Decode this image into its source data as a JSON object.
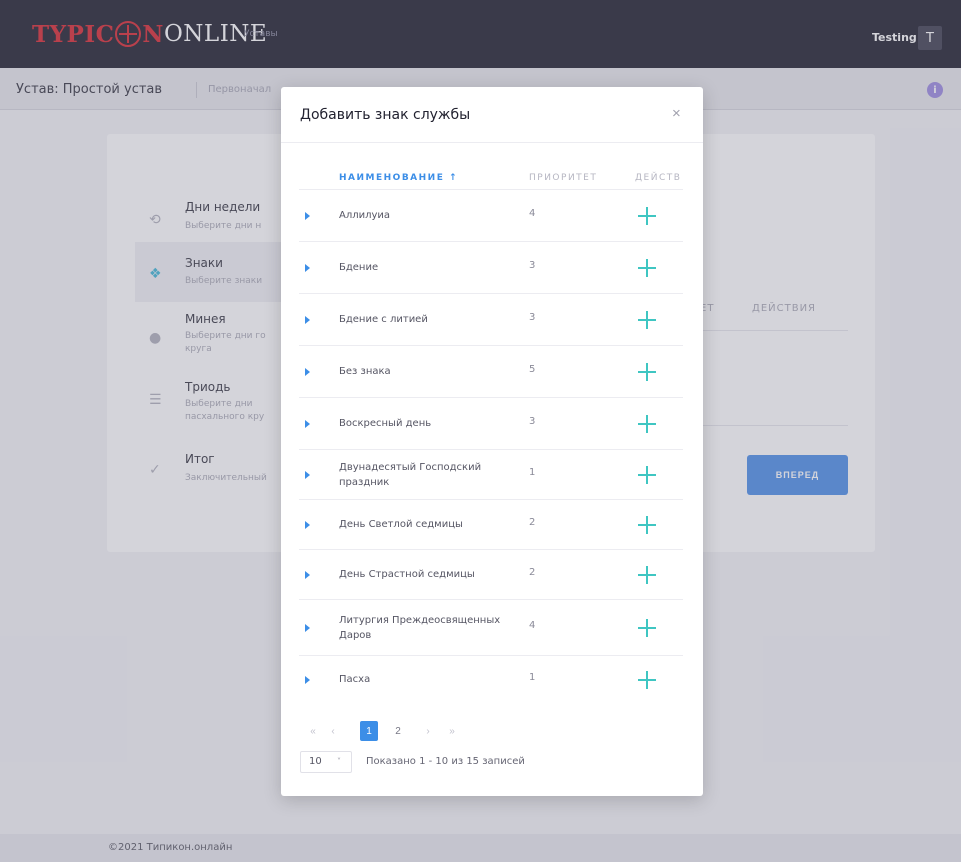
{
  "app": {
    "logo_red": "TYPIC",
    "logo_red2": "N",
    "logo_white": "ONLINE",
    "nav_link": "Уставы",
    "user_name": "Testing",
    "user_initial": "T"
  },
  "subheader": {
    "title": "Устав: Простой устав",
    "link": "Первоначал",
    "info": "i"
  },
  "steps": [
    {
      "title": "Дни недели",
      "desc": "Выберите дни н"
    },
    {
      "title": "Знаки",
      "desc": "Выберите знаки"
    },
    {
      "title": "Минея",
      "desc": "Выберите дни го круга"
    },
    {
      "title": "Триодь",
      "desc": "Выберите дни пасхального кру"
    },
    {
      "title": "Итог",
      "desc": "Заключительный"
    }
  ],
  "background_table": {
    "col_priority": "ЕТ",
    "col_actions": "ДЕЙСТВИЯ",
    "next_button": "ВПЕРЕД"
  },
  "modal": {
    "title": "Добавить знак службы",
    "close": "×",
    "columns": {
      "name": "НАИМЕНОВАНИЕ",
      "sort_arrow": "↑",
      "priority": "ПРИОРИТЕТ",
      "actions": "ДЕЙСТВ"
    },
    "rows": [
      {
        "name": "Аллилуиа",
        "priority": "4"
      },
      {
        "name": "Бдение",
        "priority": "3"
      },
      {
        "name": "Бдение с литией",
        "priority": "3"
      },
      {
        "name": "Без знака",
        "priority": "5"
      },
      {
        "name": "Воскресный день",
        "priority": "3"
      },
      {
        "name": "Двунадесятый Господский праздник",
        "priority": "1"
      },
      {
        "name": "День Светлой седмицы",
        "priority": "2"
      },
      {
        "name": "День Страстной седмицы",
        "priority": "2"
      },
      {
        "name": "Литургия Преждеосвященных Даров",
        "priority": "4"
      },
      {
        "name": "Пасха",
        "priority": "1"
      }
    ],
    "pagination": {
      "first": "«",
      "prev": "‹",
      "pages": [
        "1",
        "2"
      ],
      "current": "1",
      "next": "›",
      "last": "»",
      "per_page": "10",
      "per_page_caret": "˅",
      "shown": "Показано 1 - 10 из 15 записей"
    }
  },
  "footer": {
    "text": "©2021 Типикон.онлайн"
  }
}
